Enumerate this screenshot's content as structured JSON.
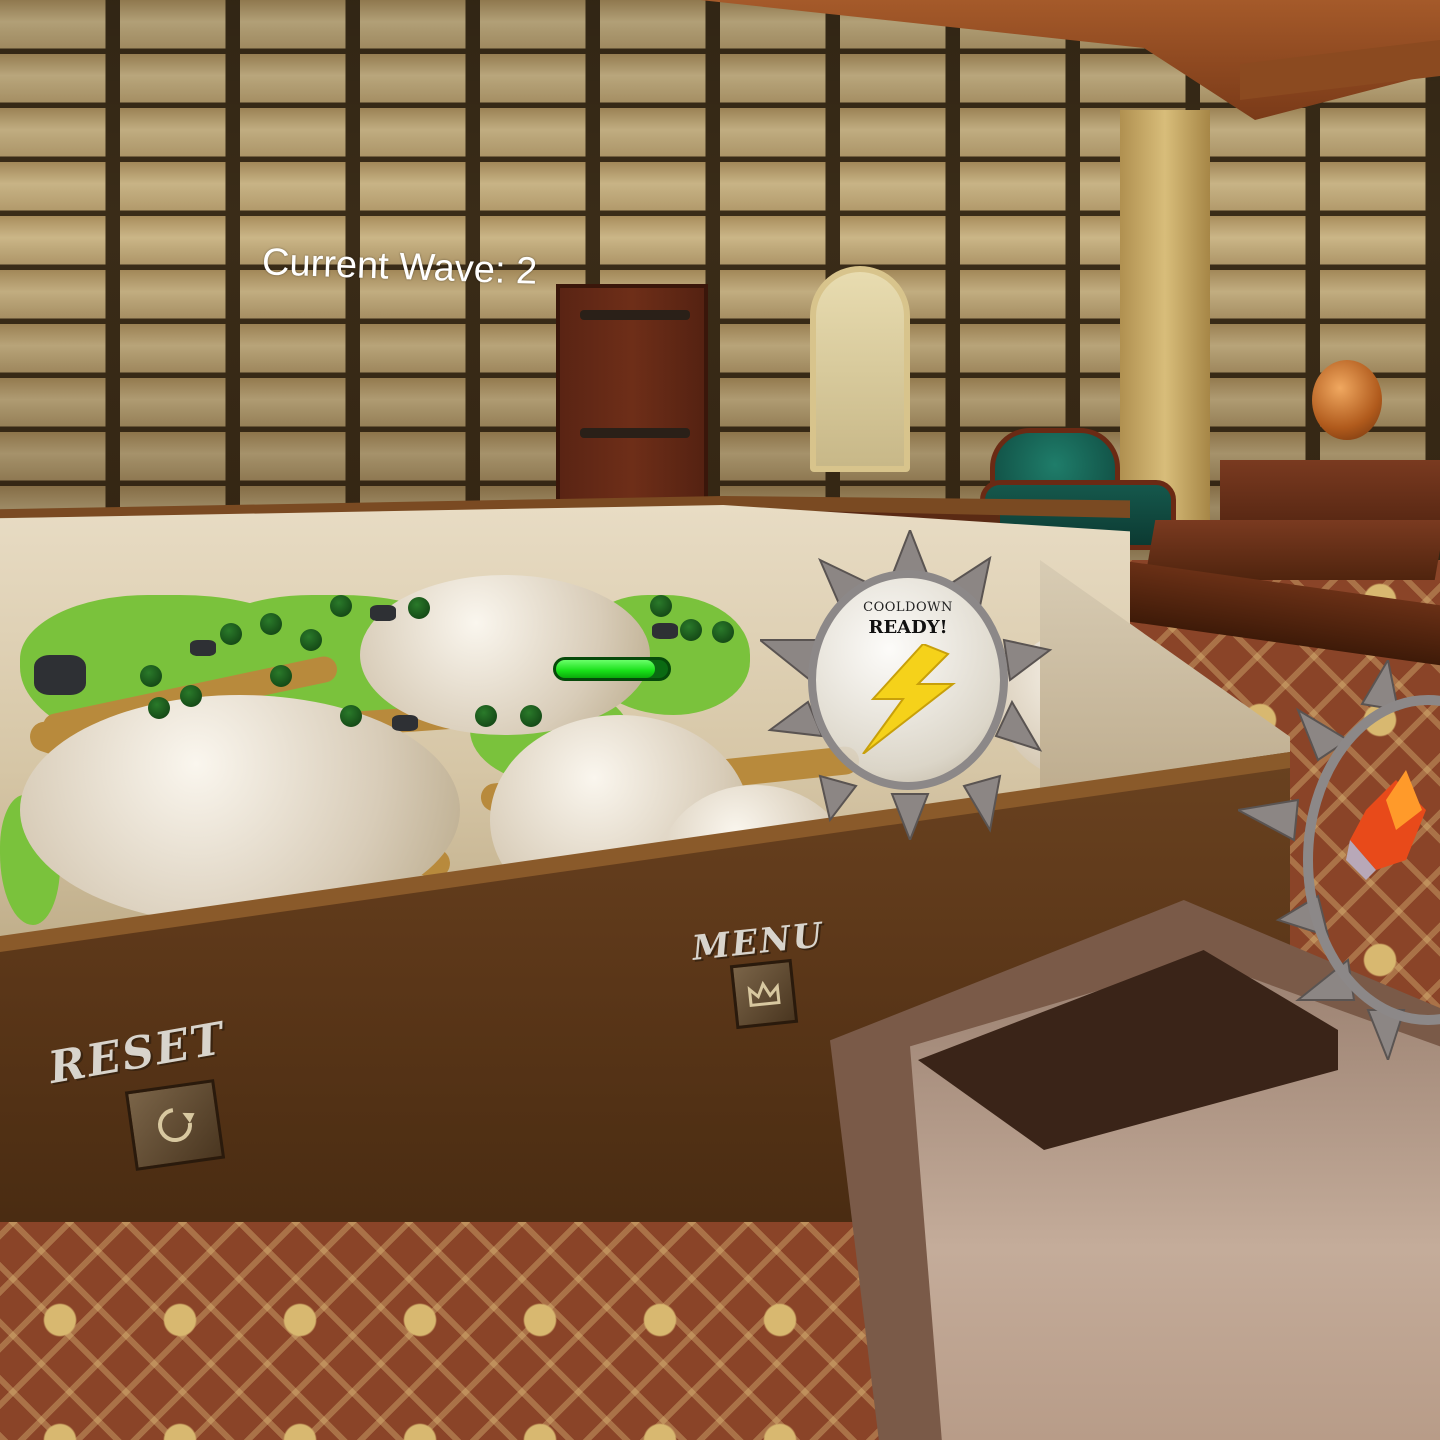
{
  "hud": {
    "wave_label": "Current Wave: 2"
  },
  "ability": {
    "cooldown_title": "COOLDOWN",
    "cooldown_status": "READY!",
    "icon": "lightning-icon"
  },
  "panel": {
    "reset_label": "RESET",
    "menu_label": "MENU",
    "reset_icon": "rotate-icon",
    "menu_icon": "crown-icon"
  },
  "enemy": {
    "health_fraction": 0.88
  },
  "colors": {
    "health_green": "#18e018",
    "lightning_yellow": "#f5d21a",
    "hud_text": "#ffffff"
  }
}
